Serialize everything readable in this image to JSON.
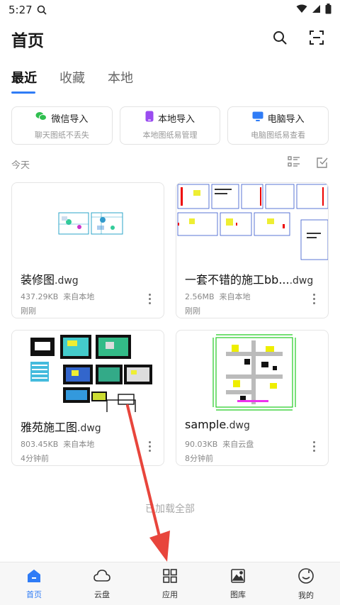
{
  "status_bar": {
    "time": "5:27"
  },
  "header": {
    "title": "首页"
  },
  "tabs": [
    {
      "label": "最近",
      "active": true
    },
    {
      "label": "收藏",
      "active": false
    },
    {
      "label": "本地",
      "active": false
    }
  ],
  "imports": [
    {
      "title": "微信导入",
      "subtitle": "聊天图纸不丢失",
      "color": "#2fbf4f"
    },
    {
      "title": "本地导入",
      "subtitle": "本地图纸易管理",
      "color": "#9a4cf0"
    },
    {
      "title": "电脑导入",
      "subtitle": "电脑图纸易查看",
      "color": "#2f7cf6"
    }
  ],
  "section_label": "今天",
  "files": [
    {
      "name": "装修图",
      "ext": ".dwg",
      "size": "437.29KB",
      "source": "来自本地",
      "time": "刚刚"
    },
    {
      "name": "一套不错的施工bb...",
      "ext": ".dwg",
      "size": "2.56MB",
      "source": "来自本地",
      "time": "刚刚"
    },
    {
      "name": "雅苑施工图",
      "ext": ".dwg",
      "size": "803.45KB",
      "source": "来自本地",
      "time": "4分钟前"
    },
    {
      "name": "sample",
      "ext": ".dwg",
      "size": "90.03KB",
      "source": "来自云盘",
      "time": "8分钟前"
    }
  ],
  "loaded_text": "已加载全部",
  "bottom_nav": [
    {
      "label": "首页",
      "icon": "home-icon",
      "active": true
    },
    {
      "label": "云盘",
      "icon": "cloud-icon",
      "active": false
    },
    {
      "label": "应用",
      "icon": "apps-grid-icon",
      "active": false
    },
    {
      "label": "图库",
      "icon": "gallery-icon",
      "active": false
    },
    {
      "label": "我的",
      "icon": "profile-icon",
      "active": false
    }
  ],
  "colors": {
    "accent": "#2f7cf6",
    "annotation_arrow": "#e8453c"
  }
}
